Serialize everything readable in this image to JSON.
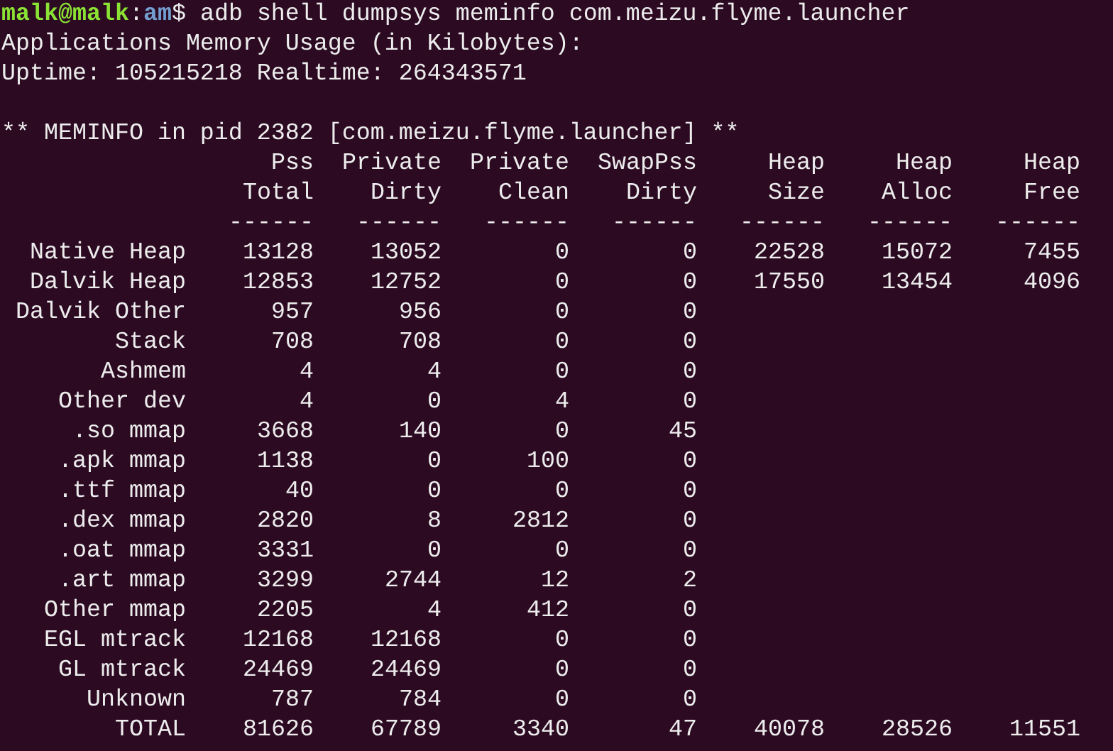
{
  "prompt": {
    "user_host": "malk@malk",
    "separator": ":",
    "path": "am",
    "symbol": "$",
    "command": "adb shell dumpsys meminfo com.meizu.flyme.launcher"
  },
  "output_lines": [
    "Applications Memory Usage (in Kilobytes):",
    "Uptime: 105215218 Realtime: 264343571"
  ],
  "meminfo_title": "** MEMINFO in pid 2382 [com.meizu.flyme.launcher] **",
  "table": {
    "columns": [
      {
        "line_1": "Pss",
        "line_2": "Total",
        "rule": "------"
      },
      {
        "line_1": "Private",
        "line_2": "Dirty",
        "rule": "------"
      },
      {
        "line_1": "Private",
        "line_2": "Clean",
        "rule": "------"
      },
      {
        "line_1": "SwapPss",
        "line_2": "Dirty",
        "rule": "------"
      },
      {
        "line_1": "Heap",
        "line_2": "Size",
        "rule": "------"
      },
      {
        "line_1": "Heap",
        "line_2": "Alloc",
        "rule": "------"
      },
      {
        "line_1": "Heap",
        "line_2": "Free",
        "rule": "------"
      }
    ],
    "rows": [
      {
        "label": "Native Heap",
        "values": [
          "13128",
          "13052",
          "0",
          "0",
          "22528",
          "15072",
          "7455"
        ]
      },
      {
        "label": "Dalvik Heap",
        "values": [
          "12853",
          "12752",
          "0",
          "0",
          "17550",
          "13454",
          "4096"
        ]
      },
      {
        "label": "Dalvik Other",
        "values": [
          "957",
          "956",
          "0",
          "0"
        ]
      },
      {
        "label": "Stack",
        "values": [
          "708",
          "708",
          "0",
          "0"
        ]
      },
      {
        "label": "Ashmem",
        "values": [
          "4",
          "4",
          "0",
          "0"
        ]
      },
      {
        "label": "Other dev",
        "values": [
          "4",
          "0",
          "4",
          "0"
        ]
      },
      {
        "label": ".so mmap",
        "values": [
          "3668",
          "140",
          "0",
          "45"
        ]
      },
      {
        "label": ".apk mmap",
        "values": [
          "1138",
          "0",
          "100",
          "0"
        ]
      },
      {
        "label": ".ttf mmap",
        "values": [
          "40",
          "0",
          "0",
          "0"
        ]
      },
      {
        "label": ".dex mmap",
        "values": [
          "2820",
          "8",
          "2812",
          "0"
        ]
      },
      {
        "label": ".oat mmap",
        "values": [
          "3331",
          "0",
          "0",
          "0"
        ]
      },
      {
        "label": ".art mmap",
        "values": [
          "3299",
          "2744",
          "12",
          "2"
        ]
      },
      {
        "label": "Other mmap",
        "values": [
          "2205",
          "4",
          "412",
          "0"
        ]
      },
      {
        "label": "EGL mtrack",
        "values": [
          "12168",
          "12168",
          "0",
          "0"
        ]
      },
      {
        "label": "GL mtrack",
        "values": [
          "24469",
          "24469",
          "0",
          "0"
        ]
      },
      {
        "label": "Unknown",
        "values": [
          "787",
          "784",
          "0",
          "0"
        ]
      },
      {
        "label": "TOTAL",
        "values": [
          "81626",
          "67789",
          "3340",
          "47",
          "40078",
          "28526",
          "11551"
        ]
      }
    ]
  }
}
